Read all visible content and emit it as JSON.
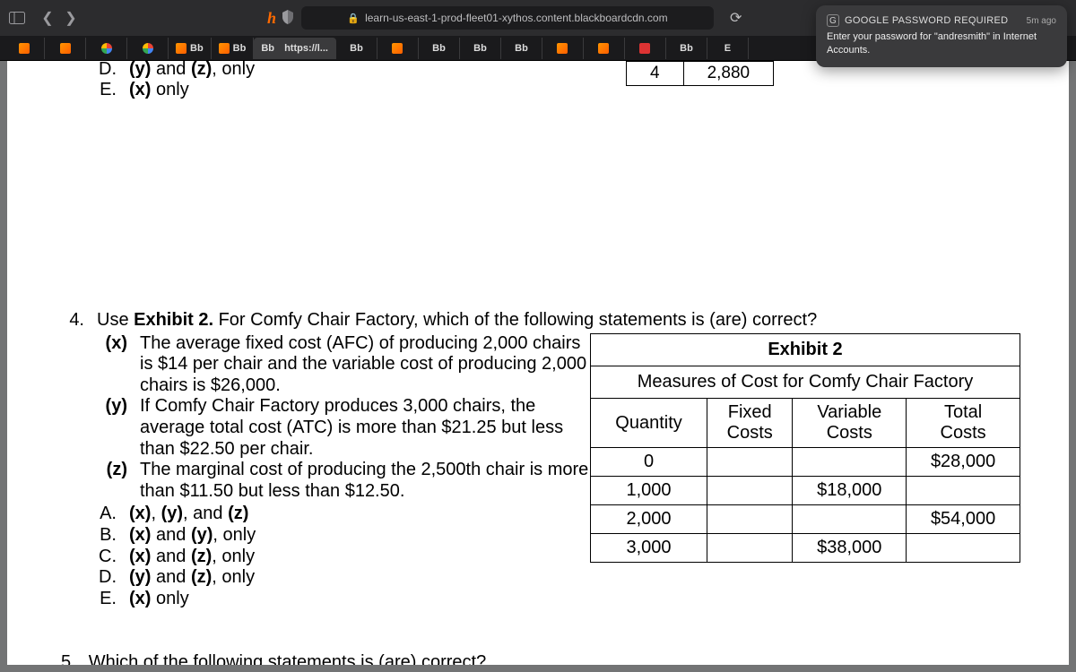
{
  "browser": {
    "url": "learn-us-east-1-prod-fleet01-xythos.content.blackboardcdn.com",
    "tabs": [
      {
        "label": ""
      },
      {
        "label": ""
      },
      {
        "label": ""
      },
      {
        "label": ""
      },
      {
        "label": ""
      },
      {
        "label": "Bb"
      },
      {
        "label": ""
      },
      {
        "label": "Bb"
      },
      {
        "label": "Bb",
        "extra": "https://l..."
      },
      {
        "label": "Bb"
      },
      {
        "label": ""
      },
      {
        "label": "Bb"
      },
      {
        "label": "Bb"
      },
      {
        "label": "Bb"
      },
      {
        "label": ""
      },
      {
        "label": ""
      },
      {
        "label": ""
      },
      {
        "label": "Bb"
      },
      {
        "label": "E"
      }
    ]
  },
  "notification": {
    "title": "GOOGLE PASSWORD REQUIRED",
    "time": "5m ago",
    "body": "Enter your password for \"andresmith\" in Internet Accounts."
  },
  "partial_top": {
    "rowD_letter": "D.",
    "rowD_text": "(y) and (z), only",
    "rowE_letter": "E.",
    "rowE_text": "(x) only",
    "mini_cell_a": "4",
    "mini_cell_b": "2,880"
  },
  "q4": {
    "num": "4.",
    "lead": "Use ",
    "lead_bold": "Exhibit 2.",
    "lead_rest": "  For Comfy Chair Factory, which of the following statements is (are) correct?",
    "stmts": [
      {
        "tag": "(x)",
        "txt": "The average fixed cost (AFC) of producing 2,000 chairs is $14 per chair and the variable cost of producing 2,000 chairs is $26,000."
      },
      {
        "tag": "(y)",
        "txt": "If Comfy Chair Factory produces 3,000 chairs, the average total cost (ATC) is more than $21.25 but less than $22.50 per chair."
      },
      {
        "tag": "(z)",
        "txt": "The marginal cost of producing the 2,500th chair is more than $11.50 but less than $12.50."
      }
    ],
    "answers": [
      {
        "letter": "A.",
        "txt_a": "(x)",
        "mid1": ", ",
        "txt_b": "(y)",
        "mid2": ", and ",
        "txt_c": "(z)"
      },
      {
        "letter": "B.",
        "txt_a": "(x)",
        "mid1": " and ",
        "txt_b": "(y)",
        "mid2": ", only"
      },
      {
        "letter": "C.",
        "txt_a": "(x)",
        "mid1": " and ",
        "txt_b": "(z)",
        "mid2": ", only"
      },
      {
        "letter": "D.",
        "txt_a": "(y)",
        "mid1": " and ",
        "txt_b": "(z)",
        "mid2": ", only"
      },
      {
        "letter": "E.",
        "txt_a": "(x)",
        "mid1": " only"
      }
    ]
  },
  "exhibit": {
    "title": "Exhibit 2",
    "subtitle": "Measures of Cost for Comfy Chair Factory",
    "headers": [
      "Quantity",
      "Fixed Costs",
      "Variable Costs",
      "Total Costs"
    ],
    "rows": [
      {
        "q": "0",
        "fc": "",
        "vc": "",
        "tc": "$28,000"
      },
      {
        "q": "1,000",
        "fc": "",
        "vc": "$18,000",
        "tc": ""
      },
      {
        "q": "2,000",
        "fc": "",
        "vc": "",
        "tc": "$54,000"
      },
      {
        "q": "3,000",
        "fc": "",
        "vc": "$38,000",
        "tc": ""
      }
    ]
  },
  "q5": {
    "num": "5.",
    "txt": "Which of the following statements is (are) correct?"
  },
  "chart_data": {
    "type": "table",
    "title": "Exhibit 2 — Measures of Cost for Comfy Chair Factory",
    "columns": [
      "Quantity",
      "Fixed Costs",
      "Variable Costs",
      "Total Costs"
    ],
    "rows": [
      [
        0,
        null,
        null,
        28000
      ],
      [
        1000,
        null,
        18000,
        null
      ],
      [
        2000,
        null,
        null,
        54000
      ],
      [
        3000,
        null,
        38000,
        null
      ]
    ]
  }
}
